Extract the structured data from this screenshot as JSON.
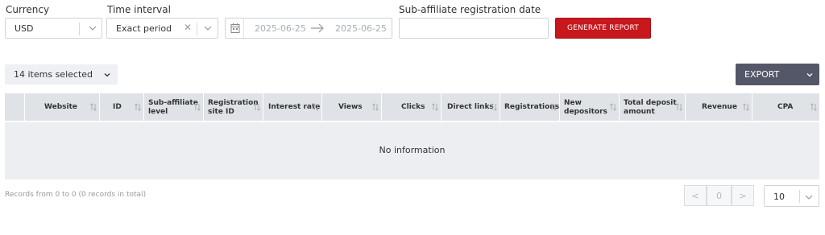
{
  "filters": {
    "currency": {
      "label": "Currency",
      "value": "USD"
    },
    "time_interval": {
      "label": "Time interval",
      "value": "Exact period"
    },
    "date_range": {
      "from": "2025-06-25",
      "to": "2025-06-25"
    },
    "sub_affiliate_date": {
      "label": "Sub-affiliate registration date",
      "value": ""
    },
    "generate_label": "GENERATE REPORT"
  },
  "toolbar": {
    "columns_selected": "14 items selected",
    "export_label": "EXPORT"
  },
  "table": {
    "columns": [
      [
        "Website"
      ],
      [
        "ID"
      ],
      [
        "Sub-affiliate",
        "level"
      ],
      [
        "Registration",
        "site ID"
      ],
      [
        "Interest rate"
      ],
      [
        "Views"
      ],
      [
        "Clicks"
      ],
      [
        "Direct links"
      ],
      [
        "Registrations"
      ],
      [
        "New",
        "depositors"
      ],
      [
        "Total deposit",
        "amount"
      ],
      [
        "Revenue"
      ],
      [
        "CPA"
      ]
    ],
    "empty_text": "No information"
  },
  "pagination": {
    "records_text": "Records from 0 to 0 (0 records in total)",
    "prev": "<",
    "current": "0",
    "next": ">",
    "page_size": "10"
  },
  "colors": {
    "generate": "#c8171d",
    "export": "#545768",
    "header_bg": "#dfe2e6",
    "body_bg": "#eceef1"
  }
}
